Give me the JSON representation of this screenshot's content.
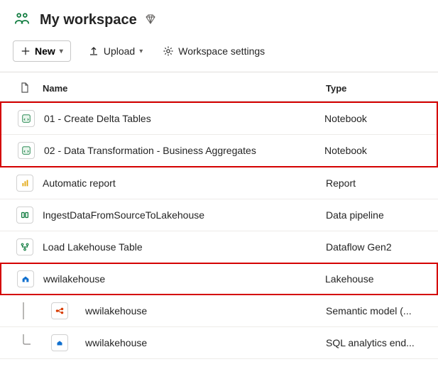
{
  "header": {
    "title": "My workspace"
  },
  "toolbar": {
    "new_label": "New",
    "upload_label": "Upload",
    "settings_label": "Workspace settings"
  },
  "table": {
    "headers": {
      "name": "Name",
      "type": "Type"
    }
  },
  "items": [
    {
      "icon": "notebook",
      "name": "01 - Create Delta Tables",
      "type": "Notebook"
    },
    {
      "icon": "notebook",
      "name": "02 - Data Transformation - Business Aggregates",
      "type": "Notebook"
    },
    {
      "icon": "report",
      "name": "Automatic report",
      "type": "Report"
    },
    {
      "icon": "pipeline",
      "name": "IngestDataFromSourceToLakehouse",
      "type": "Data pipeline"
    },
    {
      "icon": "dataflow",
      "name": "Load Lakehouse Table",
      "type": "Dataflow Gen2"
    },
    {
      "icon": "lakehouse",
      "name": "wwilakehouse",
      "type": "Lakehouse"
    }
  ],
  "children": [
    {
      "icon": "semantic",
      "name": "wwilakehouse",
      "type": "Semantic model (..."
    },
    {
      "icon": "sqlendpoint",
      "name": "wwilakehouse",
      "type": "SQL analytics end..."
    }
  ]
}
